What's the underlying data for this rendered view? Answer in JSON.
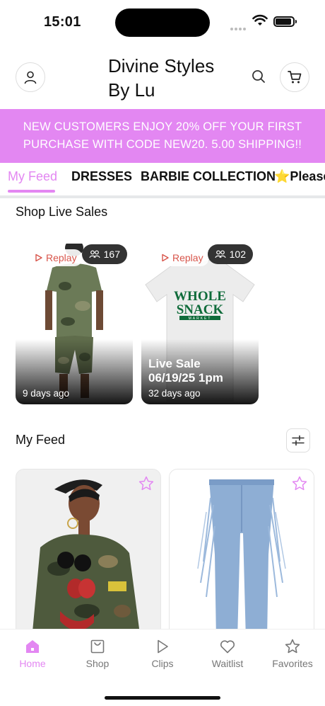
{
  "status_bar": {
    "time": "15:01"
  },
  "header": {
    "brand_line1": "Divine Styles",
    "brand_line2": "By Lu"
  },
  "promo": {
    "text": "NEW CUSTOMERS ENJOY 20% OFF YOUR FIRST PURCHASE WITH CODE NEW20. 5.00 SHIPPING!!"
  },
  "tabs": [
    {
      "label": "My Feed",
      "active": true
    },
    {
      "label": "DRESSES"
    },
    {
      "label": "BARBIE COLLECTION"
    },
    {
      "label": "⭐Please"
    }
  ],
  "live_sales": {
    "title": "Shop Live Sales",
    "cards": [
      {
        "replay": "Replay",
        "viewers": "167",
        "title": "",
        "ago": "9 days ago"
      },
      {
        "replay": "Replay",
        "viewers": "102",
        "title_line1": "Live Sale",
        "title_line2": "06/19/25 1pm",
        "ago": "32 days ago"
      }
    ]
  },
  "tee_print": {
    "line1": "WHOLE",
    "line2": "SNACK",
    "line3": "MARKET"
  },
  "feed": {
    "title": "My Feed"
  },
  "bottom_nav": [
    {
      "label": "Home",
      "active": true,
      "icon": "home-icon"
    },
    {
      "label": "Shop",
      "icon": "bag-icon"
    },
    {
      "label": "Clips",
      "icon": "play-icon"
    },
    {
      "label": "Waitlist",
      "icon": "heart-icon"
    },
    {
      "label": "Favorites",
      "icon": "star-icon"
    }
  ],
  "colors": {
    "accent": "#e387f2",
    "replay": "#d8554b"
  }
}
